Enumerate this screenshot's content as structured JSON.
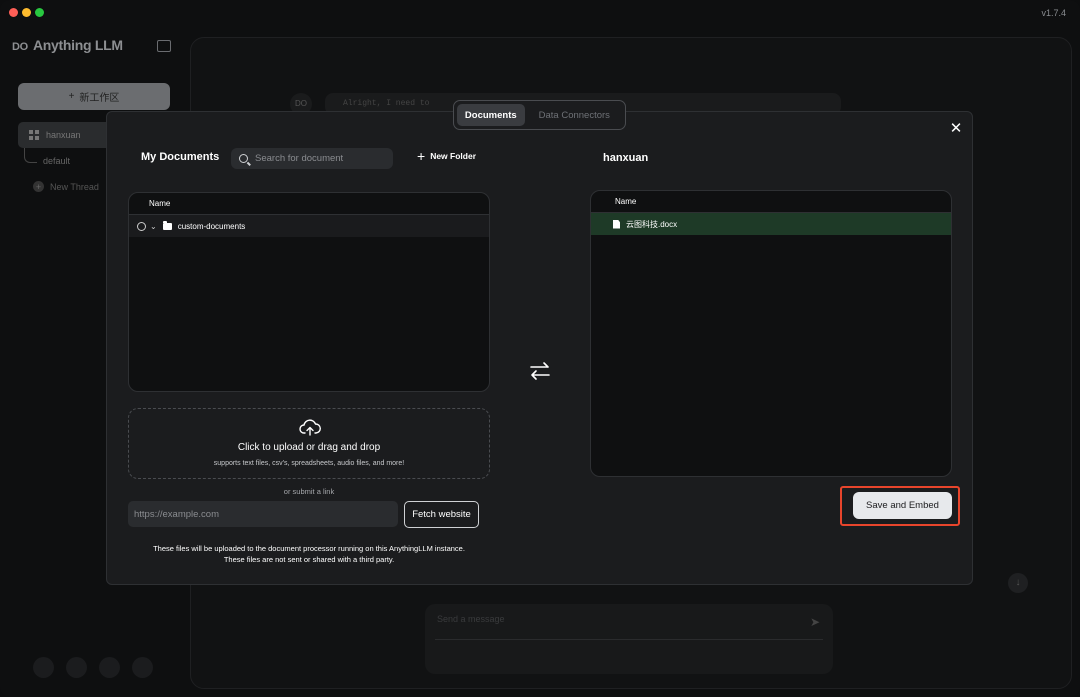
{
  "app": {
    "version": "v1.7.4",
    "brand_name": "Anything LLM",
    "brand_logo_text": "DO"
  },
  "sidebar": {
    "new_workspace_label": "新工作区",
    "workspace_name": "hanxuan",
    "thread_default": "default",
    "new_thread_label": "New Thread"
  },
  "background_chat": {
    "avatar_text": "DO",
    "message_snippet": "Alright, I need to",
    "input_placeholder": "Send a message"
  },
  "modal": {
    "tabs": [
      {
        "label": "Documents",
        "active": true
      },
      {
        "label": "Data Connectors",
        "active": false
      }
    ],
    "left": {
      "title": "My Documents",
      "search_placeholder": "Search for document",
      "new_folder_label": "New Folder",
      "list_header": "Name",
      "folders": [
        {
          "name": "custom-documents"
        }
      ],
      "upload_title": "Click to upload or drag and drop",
      "upload_subtitle": "supports text files, csv's, spreadsheets, audio files, and more!",
      "or_link_label": "or submit a link",
      "url_placeholder": "https://example.com",
      "fetch_label": "Fetch website",
      "disclaimer_line1": "These files will be uploaded to the document processor running on this AnythingLLM instance.",
      "disclaimer_line2": "These files are not sent or shared with a third party."
    },
    "right": {
      "title": "hanxuan",
      "list_header": "Name",
      "files": [
        {
          "name": "云图科技.docx"
        }
      ],
      "save_label": "Save and Embed"
    }
  },
  "colors": {
    "accent_highlight": "#e8452c",
    "embedded_row": "#1e3a27",
    "modal_bg": "#1b1c1e"
  }
}
